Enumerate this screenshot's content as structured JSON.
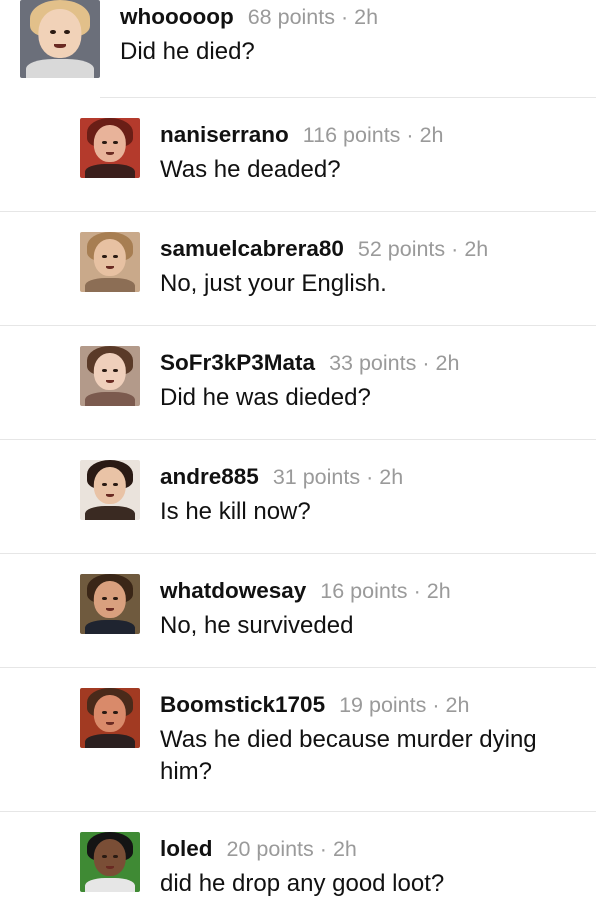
{
  "comments": [
    {
      "username": "whooooop",
      "points": "68 points",
      "age": "2h",
      "text": "Did he died?",
      "avatar": {
        "bg": "#6b6f7a",
        "hair": "#e2c08a",
        "skin": "#f1d2b8",
        "body": "#d9d9d9"
      }
    },
    {
      "username": "naniserrano",
      "points": "116 points",
      "age": "2h",
      "text": "Was he deaded?",
      "avatar": {
        "bg": "#b43a2c",
        "hair": "#6a1e16",
        "skin": "#e8b39a",
        "body": "#3b1f1c"
      }
    },
    {
      "username": "samuelcabrera80",
      "points": "52 points",
      "age": "2h",
      "text": "No, just your English.",
      "avatar": {
        "bg": "#c9a98a",
        "hair": "#a77e52",
        "skin": "#e7c1a2",
        "body": "#8c6e55"
      }
    },
    {
      "username": "SoFr3kP3Mata",
      "points": "33 points",
      "age": "2h",
      "text": "Did he was dieded?",
      "avatar": {
        "bg": "#b39a8a",
        "hair": "#5a3a28",
        "skin": "#efcfbb",
        "body": "#7b5a4e"
      }
    },
    {
      "username": "andre885",
      "points": "31 points",
      "age": "2h",
      "text": "Is he kill now?",
      "avatar": {
        "bg": "#eae3dc",
        "hair": "#2a1a14",
        "skin": "#e9c3a6",
        "body": "#3a2a22"
      }
    },
    {
      "username": "whatdowesay",
      "points": "16 points",
      "age": "2h",
      "text": "No, he surviveded",
      "avatar": {
        "bg": "#6f5a3e",
        "hair": "#3a2617",
        "skin": "#d9a07e",
        "body": "#1f2430"
      }
    },
    {
      "username": "Boomstick1705",
      "points": "19 points",
      "age": "2h",
      "text": "Was he died because murder dying him?",
      "avatar": {
        "bg": "#a23a22",
        "hair": "#4a2a1a",
        "skin": "#d98a6a",
        "body": "#2b2020"
      }
    },
    {
      "username": "loled",
      "points": "20 points",
      "age": "2h",
      "text": "did he drop any good loot?",
      "avatar": {
        "bg": "#3f8a34",
        "hair": "#141414",
        "skin": "#7a4e36",
        "body": "#e6e6e6"
      }
    }
  ]
}
